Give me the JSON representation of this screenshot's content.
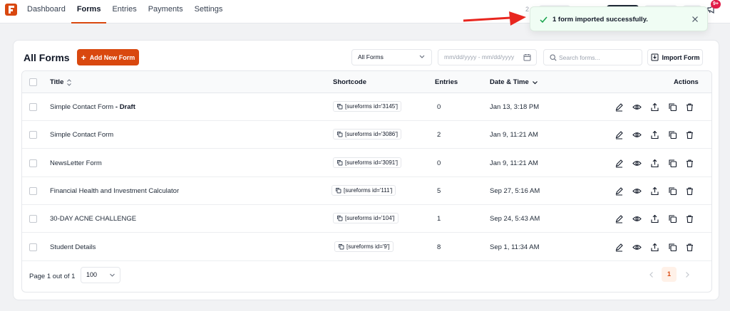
{
  "nav": {
    "items": [
      {
        "label": "Dashboard",
        "active": false
      },
      {
        "label": "Forms",
        "active": true
      },
      {
        "label": "Entries",
        "active": false
      },
      {
        "label": "Payments",
        "active": false
      },
      {
        "label": "Settings",
        "active": false
      }
    ],
    "notification_count": "9+",
    "partial_text": "2"
  },
  "header": {
    "title": "All Forms",
    "add_button": "Add New Form",
    "status_filter": "All Forms",
    "date_placeholder": "mm/dd/yyyy - mm/dd/yyyy",
    "search_placeholder": "Search forms...",
    "import_button": "Import Form"
  },
  "table": {
    "columns": {
      "title": "Title",
      "shortcode": "Shortcode",
      "entries": "Entries",
      "datetime": "Date & Time",
      "actions": "Actions"
    },
    "rows": [
      {
        "title": "Simple Contact Form",
        "status": "Draft",
        "shortcode": "[sureforms id='3145']",
        "entries": "0",
        "date": "Jan 13, 3:18 PM"
      },
      {
        "title": "Simple Contact Form",
        "status": "",
        "shortcode": "[sureforms id='3086']",
        "entries": "2",
        "date": "Jan 9, 11:21 AM"
      },
      {
        "title": "NewsLetter Form",
        "status": "",
        "shortcode": "[sureforms id='3091']",
        "entries": "0",
        "date": "Jan 9, 11:21 AM"
      },
      {
        "title": "Financial Health and Investment Calculator",
        "status": "",
        "shortcode": "[sureforms id='111']",
        "entries": "5",
        "date": "Sep 27, 5:16 AM"
      },
      {
        "title": "30-DAY ACNE CHALLENGE",
        "status": "",
        "shortcode": "[sureforms id='104']",
        "entries": "1",
        "date": "Sep 24, 5:43 AM"
      },
      {
        "title": "Student Details",
        "status": "",
        "shortcode": "[sureforms id='9']",
        "entries": "8",
        "date": "Sep 1, 11:34 AM"
      }
    ]
  },
  "footer": {
    "page_text": "Page 1 out of 1",
    "per_page": "100",
    "current_page": "1"
  },
  "toast": {
    "message": "1 form imported successfully."
  },
  "colors": {
    "accent": "#d9480f",
    "toast_bg": "#f0fdf4",
    "success": "#16a34a",
    "annotation_arrow": "#e8261f"
  }
}
